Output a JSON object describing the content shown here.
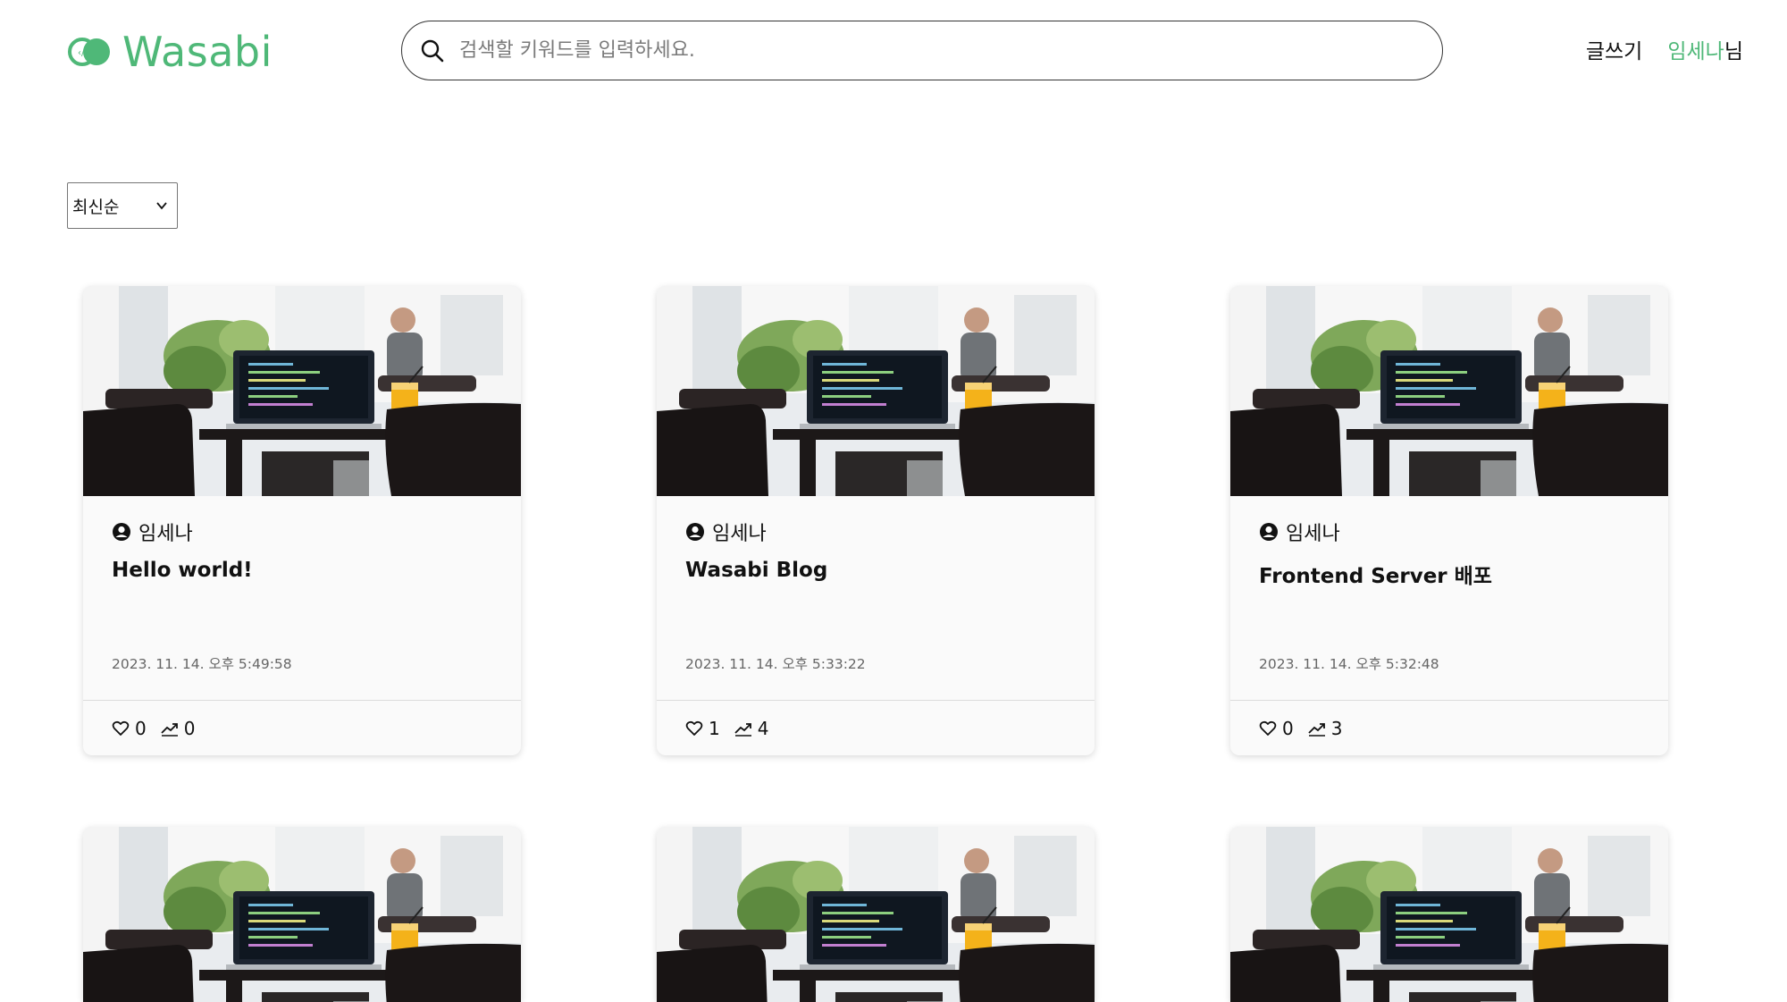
{
  "header": {
    "logo_text": "Wasabi",
    "search_placeholder": "검색할 키워드를 입력하세요.",
    "write_label": "글쓰기",
    "user_name": "임세나",
    "user_suffix": "님"
  },
  "sort": {
    "selected": "최신순"
  },
  "colors": {
    "brand": "#4fb878"
  },
  "posts": [
    {
      "author": "임세나",
      "title": "Hello world!",
      "date": "2023. 11. 14. 오후 5:49:58",
      "likes": "0",
      "views": "0"
    },
    {
      "author": "임세나",
      "title": "Wasabi Blog",
      "date": "2023. 11. 14. 오후 5:33:22",
      "likes": "1",
      "views": "4"
    },
    {
      "author": "임세나",
      "title": "Frontend Server 배포",
      "date": "2023. 11. 14. 오후 5:32:48",
      "likes": "0",
      "views": "3"
    },
    {
      "author": "",
      "title": "",
      "date": "",
      "likes": "",
      "views": ""
    },
    {
      "author": "",
      "title": "",
      "date": "",
      "likes": "",
      "views": ""
    },
    {
      "author": "",
      "title": "",
      "date": "",
      "likes": "",
      "views": ""
    }
  ]
}
